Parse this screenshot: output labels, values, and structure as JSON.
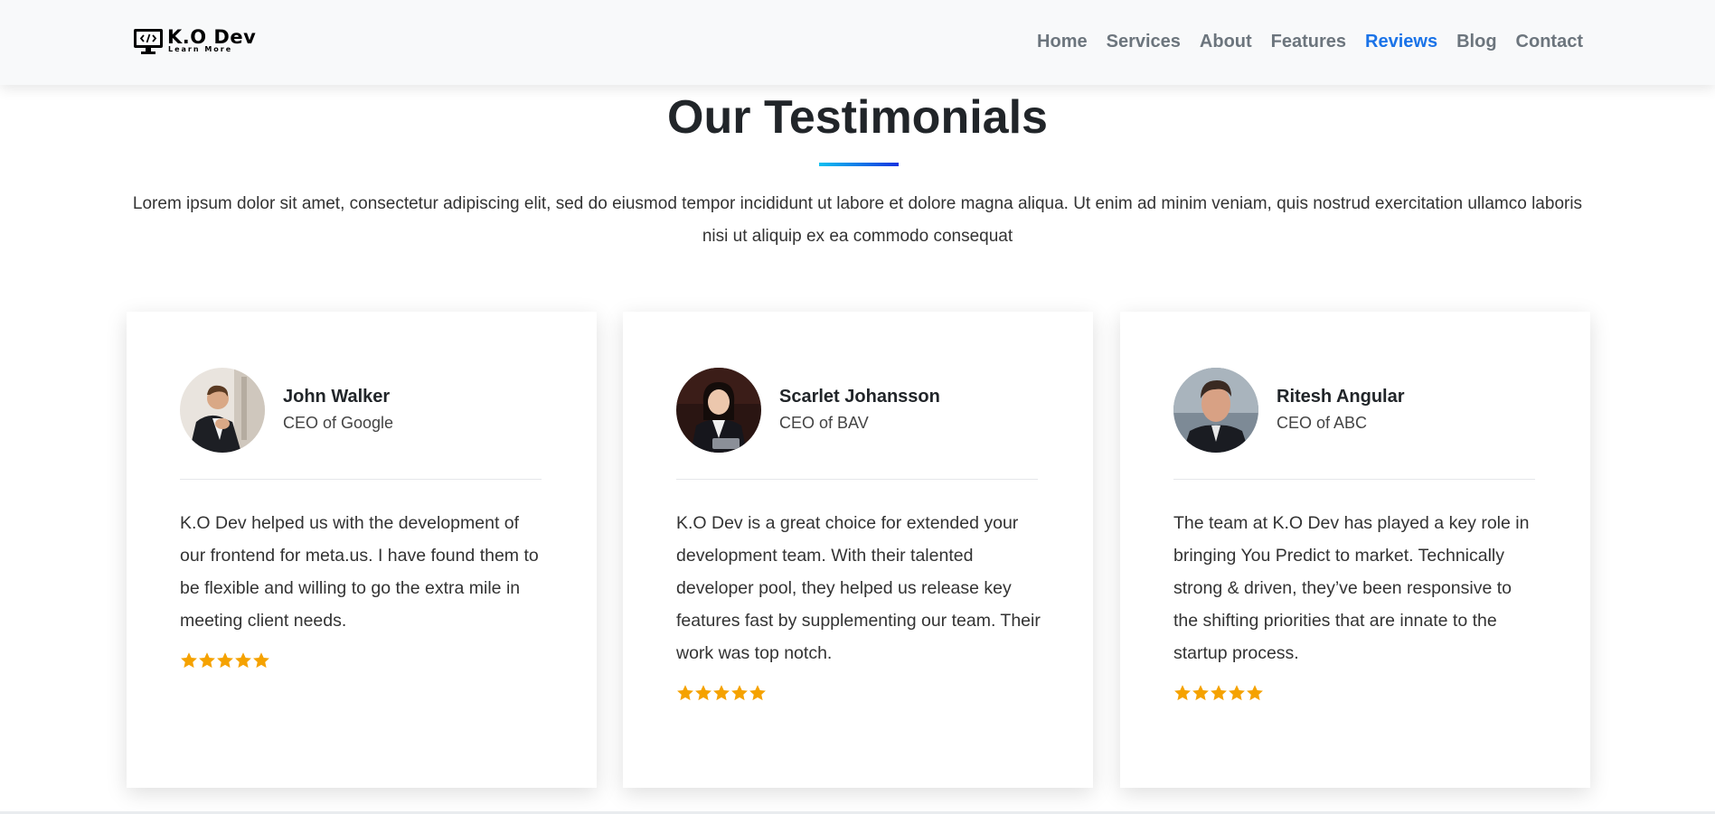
{
  "brand": {
    "name": "K.O Dev",
    "tagline": "Learn More"
  },
  "nav": {
    "items": [
      {
        "label": "Home"
      },
      {
        "label": "Services"
      },
      {
        "label": "About"
      },
      {
        "label": "Features"
      },
      {
        "label": "Reviews",
        "active": true
      },
      {
        "label": "Blog"
      },
      {
        "label": "Contact"
      }
    ]
  },
  "testimonials": {
    "title": "Our Testimonials",
    "intro": "Lorem ipsum dolor sit amet, consectetur adipiscing elit, sed do eiusmod tempor incididunt ut labore et dolore magna aliqua. Ut enim ad minim veniam, quis nostrud exercitation ullamco laboris nisi ut aliquip ex ea commodo consequat",
    "cards": [
      {
        "name": "John Walker",
        "role": "CEO of Google",
        "quote": "K.O Dev helped us with the development of our frontend for meta.us. I have found them to be flexible and willing to go the extra mile in meeting client needs.",
        "rating": 5
      },
      {
        "name": "Scarlet Johansson",
        "role": "CEO of BAV",
        "quote": "K.O Dev is a great choice for extended your development team. With their talented developer pool, they helped us release key features fast by supplementing our team. Their work was top notch.",
        "rating": 5
      },
      {
        "name": "Ritesh Angular",
        "role": "CEO of ABC",
        "quote": "The team at K.O Dev has played a key role in bringing You Predict to market. Technically strong & driven, they’ve been responsive to the shifting priorities that are innate to the startup process.",
        "rating": 5
      }
    ]
  },
  "colors": {
    "accent": "#1a73e8",
    "nav_text": "#6c757d",
    "star": "#f5a200",
    "underline_start": "#0cc0f0",
    "underline_end": "#1433e0"
  }
}
